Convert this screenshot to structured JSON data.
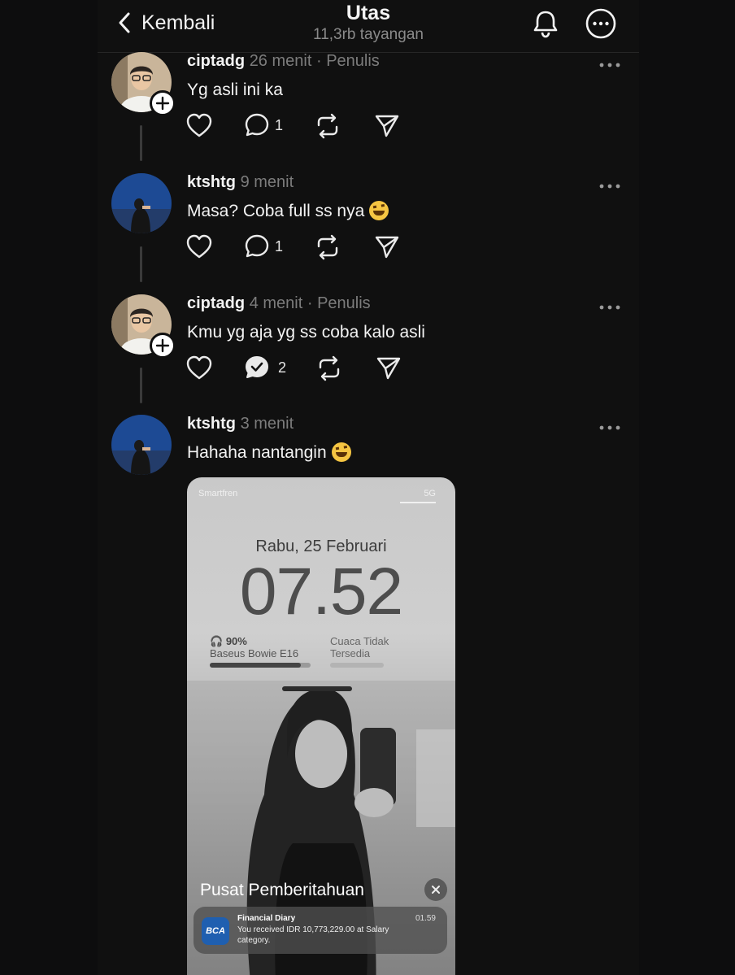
{
  "header": {
    "back_label": "Kembali",
    "title": "Utas",
    "subtitle": "11,3rb tayangan"
  },
  "posts": [
    {
      "username": "ciptadg",
      "time": "26 menit",
      "role": "Penulis",
      "text": "Yg asli ini ka",
      "reply_count": "1",
      "emoji": false,
      "avatar": "man-glasses"
    },
    {
      "username": "ktshtg",
      "time": "9 menit",
      "role": "",
      "text": "Masa? Coba full ss nya",
      "reply_count": "1",
      "emoji": true,
      "avatar": "woman-blue"
    },
    {
      "username": "ciptadg",
      "time": "4 menit",
      "role": "Penulis",
      "text": "Kmu yg aja yg ss coba kalo asli",
      "reply_count": "2",
      "emoji": false,
      "avatar": "man-glasses"
    },
    {
      "username": "ktshtg",
      "time": "3 menit",
      "role": "",
      "text": "Hahaha nantangin",
      "emoji": true,
      "avatar": "woman-blue"
    }
  ],
  "separator": "·",
  "screenshot": {
    "carrier": "Smartfren",
    "status": "5G",
    "date": "Rabu, 25 Februari",
    "clock": "07.52",
    "battery_percent": "90%",
    "battery_level": 0.9,
    "battery_device": "Baseus Bowie E16",
    "weather_line1": "Cuaca Tidak",
    "weather_line2": "Tersedia",
    "notification_center": "Pusat Pemberitahuan",
    "notif_icon_text": "BCA",
    "notif_app": "Financial Diary",
    "notif_time": "01.59",
    "notif_body": "You received IDR 10,773,229.00 at Salary category."
  },
  "icons": {
    "back": "chevron-left-icon",
    "bell": "bell-icon",
    "more": "more-circle-icon",
    "like": "heart-icon",
    "reply": "comment-icon",
    "repost": "repost-icon",
    "share": "send-icon"
  },
  "colors": {
    "background": "#101010",
    "muted": "#7c7c7c",
    "text": "#f3f3f3"
  }
}
